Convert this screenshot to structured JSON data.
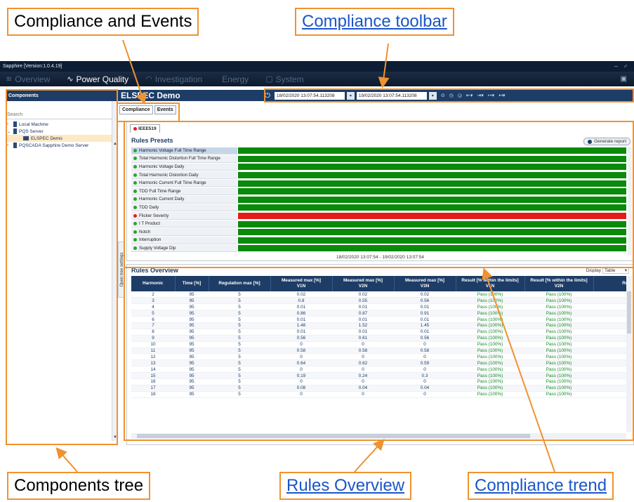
{
  "callouts": {
    "compliance_events": "Compliance and Events",
    "compliance_toolbar": "Compliance toolbar",
    "components_tree": "Components tree",
    "rules_overview": "Rules Overview",
    "compliance_trend": "Compliance trend"
  },
  "app": {
    "window_title": "Sapphire [Version:1.0.4.19]",
    "window_buttons": "– ♂",
    "menu": [
      "Overview",
      "Power Quality",
      "Investigation",
      "Energy",
      "System"
    ],
    "active_menu": "Power Quality"
  },
  "sidebar": {
    "header": "Components",
    "search_placeholder": "Search",
    "tree": [
      {
        "label": "Local Machine",
        "level": 0,
        "arrow": "›"
      },
      {
        "label": "PQS Server",
        "level": 0,
        "arrow": "⌄"
      },
      {
        "label": "ELSPEC Demo",
        "level": 1,
        "arrow": ""
      },
      {
        "label": "PQSCADA Sapphire Demo Server",
        "level": 0,
        "arrow": "›"
      }
    ],
    "tree_settings_label": "Open tree settings"
  },
  "main": {
    "title": "ELSPEC Demo",
    "date_from": "18/02/2020 13:07:54.113208",
    "date_to": "19/02/2020 13:07:54.113208",
    "tabs": [
      "Compliance",
      "Events"
    ],
    "active_tab": "Compliance"
  },
  "trend": {
    "standard_tab": "IEEE519",
    "title": "Rules Presets",
    "generate_label": "Generate report",
    "range_label": "18/02/2020 13:07:54 - 19/02/2020 13:07:54",
    "presets": [
      {
        "label": "Harmonic Voltage Full Time Range",
        "status": "pass"
      },
      {
        "label": "Total Harmonic Distortion Full Time Range",
        "status": "pass"
      },
      {
        "label": "Harmonic Voltage Daily",
        "status": "pass"
      },
      {
        "label": "Total Harmonic Distortion Daily",
        "status": "pass"
      },
      {
        "label": "Harmonic Current Full Time Range",
        "status": "pass"
      },
      {
        "label": "TDD Full Time Range",
        "status": "pass"
      },
      {
        "label": "Harmonic Current Daily",
        "status": "pass"
      },
      {
        "label": "TDD Daily",
        "status": "pass"
      },
      {
        "label": "Flicker Severity",
        "status": "fail"
      },
      {
        "label": "I T Product",
        "status": "pass"
      },
      {
        "label": "Notch",
        "status": "pass"
      },
      {
        "label": "Interruption",
        "status": "pass"
      },
      {
        "label": "Supply Voltage Dip",
        "status": "pass"
      }
    ],
    "colors": {
      "pass": "#0a8a0a",
      "fail": "#e51a1a",
      "dot_pass": "#2aa52a",
      "dot_fail": "#e02020"
    }
  },
  "overview": {
    "title": "Rules Overview",
    "display_label": "Display",
    "display_value": "Table",
    "columns": [
      "Harmonic",
      "Time [%]",
      "Regulation max [%]",
      "Measured max [%]\nV1N",
      "Measured max [%]\nV2N",
      "Measured max [%]\nV3N",
      "Result [% within the limits]\nV1N",
      "Result [% within the limits]\nV2N",
      "Result"
    ],
    "rows": [
      [
        "2",
        "95",
        "5",
        "0.02",
        "0.02",
        "0.02",
        "Pass (100%)",
        "Pass (100%)",
        ""
      ],
      [
        "3",
        "95",
        "5",
        "0.8",
        "0.55",
        "0.56",
        "Pass (100%)",
        "Pass (100%)",
        ""
      ],
      [
        "4",
        "95",
        "5",
        "0.01",
        "0.01",
        "0.01",
        "Pass (100%)",
        "Pass (100%)",
        ""
      ],
      [
        "5",
        "95",
        "5",
        "0.86",
        "0.87",
        "0.91",
        "Pass (100%)",
        "Pass (100%)",
        ""
      ],
      [
        "6",
        "95",
        "5",
        "0.01",
        "0.01",
        "0.01",
        "Pass (100%)",
        "Pass (100%)",
        ""
      ],
      [
        "7",
        "95",
        "5",
        "1.48",
        "1.52",
        "1.45",
        "Pass (100%)",
        "Pass (100%)",
        ""
      ],
      [
        "8",
        "95",
        "5",
        "0.01",
        "0.01",
        "0.01",
        "Pass (100%)",
        "Pass (100%)",
        ""
      ],
      [
        "9",
        "95",
        "5",
        "0.56",
        "0.61",
        "0.56",
        "Pass (100%)",
        "Pass (100%)",
        ""
      ],
      [
        "10",
        "95",
        "5",
        "0",
        "0",
        "0",
        "Pass (100%)",
        "Pass (100%)",
        ""
      ],
      [
        "11",
        "95",
        "5",
        "0.58",
        "0.58",
        "0.58",
        "Pass (100%)",
        "Pass (100%)",
        ""
      ],
      [
        "12",
        "95",
        "5",
        "0",
        "0",
        "0",
        "Pass (100%)",
        "Pass (100%)",
        ""
      ],
      [
        "13",
        "95",
        "5",
        "0.64",
        "0.62",
        "0.59",
        "Pass (100%)",
        "Pass (100%)",
        ""
      ],
      [
        "14",
        "95",
        "5",
        "0",
        "0",
        "0",
        "Pass (100%)",
        "Pass (100%)",
        ""
      ],
      [
        "15",
        "95",
        "5",
        "0.19",
        "0.24",
        "0.3",
        "Pass (100%)",
        "Pass (100%)",
        ""
      ],
      [
        "16",
        "95",
        "5",
        "0",
        "0",
        "0",
        "Pass (100%)",
        "Pass (100%)",
        ""
      ],
      [
        "17",
        "95",
        "5",
        "0.08",
        "0.04",
        "0.04",
        "Pass (100%)",
        "Pass (100%)",
        ""
      ],
      [
        "18",
        "95",
        "5",
        "0",
        "0",
        "0",
        "Pass (100%)",
        "Pass (100%)",
        ""
      ]
    ]
  }
}
